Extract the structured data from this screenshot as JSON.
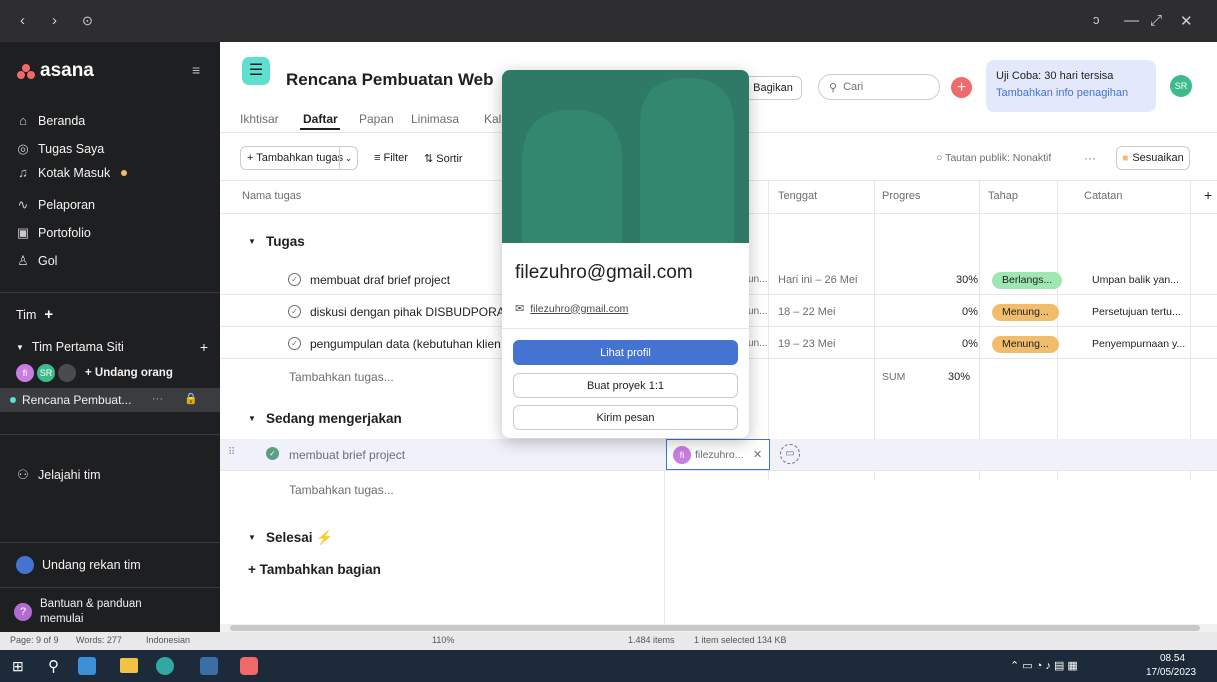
{
  "titlebar": {
    "back": "‹",
    "forward": "›",
    "history": "⊙",
    "minimize": "—",
    "restore": "⤢",
    "close": "✕",
    "extra": "ↄ"
  },
  "sidebar": {
    "logo": "asana",
    "collapse": "≡",
    "items": [
      {
        "label": "Beranda",
        "icon": "home-icon"
      },
      {
        "label": "Tugas Saya",
        "icon": "check-circle-icon"
      },
      {
        "label": "Kotak Masuk",
        "icon": "bell-icon"
      },
      {
        "label": "Pelaporan",
        "icon": "chart-line-icon"
      },
      {
        "label": "Portofolio",
        "icon": "portfolio-icon"
      },
      {
        "label": "Gol",
        "icon": "person-icon"
      }
    ],
    "team_header": "Tim",
    "team_add": "+",
    "team_name": "Tim Pertama Siti",
    "invite": "+ Undang orang",
    "avatar1": "fi",
    "avatar2": "SR",
    "project": "Rencana Pembuat...",
    "project_more": "···",
    "explore": "Jelajahi tim",
    "invite_team": "Undang rekan tim",
    "help_line1": "Bantuan & panduan",
    "help_line2": "memulai"
  },
  "header": {
    "title": "Rencana Pembuatan Web",
    "tabs": [
      "Ikhtisar",
      "Daftar",
      "Papan",
      "Linimasa",
      "Kal"
    ],
    "active_tab": "Daftar",
    "share": "Bagikan",
    "search_placeholder": "Cari",
    "trial_line1": "Uji Coba: 30 hari tersisa",
    "trial_line2": "Tambahkan info penagihan",
    "user_avatar": "SR"
  },
  "toolbar": {
    "add_task": "+ Tambahkan tugas",
    "filter": "Filter",
    "sort": "Sortir",
    "public_link": "Tautan publik: Nonaktif",
    "more": "···",
    "customize": "Sesuaikan"
  },
  "columns": [
    "Nama tugas",
    "Tenggat",
    "Progres",
    "Tahap",
    "Catatan",
    "+"
  ],
  "sections": [
    {
      "name": "Tugas"
    },
    {
      "name": "Sedang mengerjakan"
    },
    {
      "name": "Selesai ⚡"
    }
  ],
  "tasks": [
    {
      "name": "membuat draf brief project",
      "assignee": "un...",
      "due": "Hari ini – 26 Mei",
      "progress": "30%",
      "stage": "Berlangs...",
      "note": "Umpan balik yan..."
    },
    {
      "name": "diskusi dengan pihak DISBUDPORAPAR",
      "assignee": "un...",
      "due": "18 – 22 Mei",
      "progress": "0%",
      "stage": "Menung...",
      "note": "Persetujuan tertu..."
    },
    {
      "name": "pengumpulan data (kebutuhan klien ya",
      "assignee": "un...",
      "due": "19 – 23 Mei",
      "progress": "0%",
      "stage": "Menung...",
      "note": "Penyempurnaan y..."
    }
  ],
  "add_task_row": "Tambahkan tugas...",
  "sum_label": "SUM",
  "sum_value": "30%",
  "active_task": {
    "name": "membuat brief project",
    "assignee_initials": "fi",
    "assignee": "filezuhro...",
    "close": "✕"
  },
  "add_section": "+ Tambahkan bagian",
  "popup": {
    "name": "filezuhro@gmail.com",
    "email": "filezuhro@gmail.com",
    "view_profile": "Lihat profil",
    "new_project": "Buat proyek 1:1",
    "send_message": "Kirim pesan"
  },
  "statusbar": {
    "page": "Page: 9 of 9",
    "words": "Words: 277",
    "lang": "Indonesian",
    "zoom": "110%",
    "items": "1.484 items",
    "selected": "1 item selected  134 KB"
  },
  "taskbar": {
    "time": "08.54",
    "date": "17/05/2023"
  }
}
